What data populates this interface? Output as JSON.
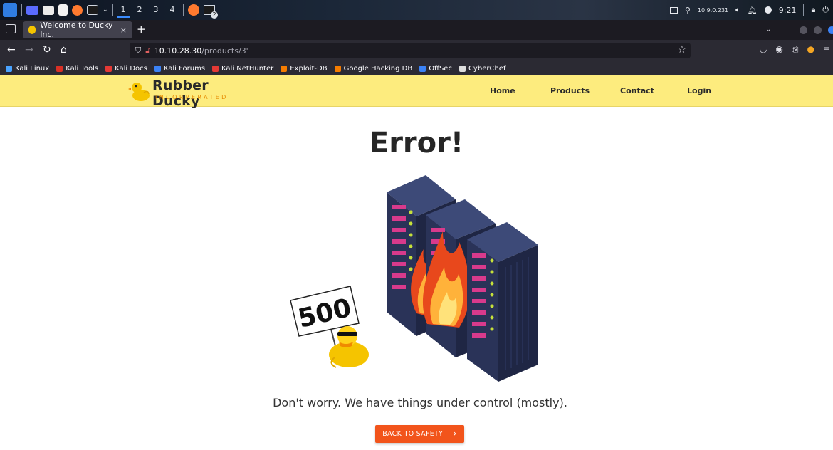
{
  "os": {
    "workspaces": [
      "1",
      "2",
      "3",
      "4"
    ],
    "active_workspace": "1",
    "ip": "10.9.0.231",
    "clock": "9:21",
    "terminal_badge": "2"
  },
  "browser": {
    "tab_title": "Welcome to Ducky Inc.",
    "tab_close": "×",
    "new_tab": "+",
    "url_host": "10.10.28.30",
    "url_path": "/products/3'",
    "bookmarks": [
      {
        "label": "Kali Linux",
        "color": "#4aa3ff"
      },
      {
        "label": "Kali Tools",
        "color": "#d93025"
      },
      {
        "label": "Kali Docs",
        "color": "#e53935"
      },
      {
        "label": "Kali Forums",
        "color": "#3b82f6"
      },
      {
        "label": "Kali NetHunter",
        "color": "#e53935"
      },
      {
        "label": "Exploit-DB",
        "color": "#f57c00"
      },
      {
        "label": "Google Hacking DB",
        "color": "#f57c00"
      },
      {
        "label": "OffSec",
        "color": "#3b82f6"
      },
      {
        "label": "CyberChef",
        "color": "#dddddd"
      }
    ]
  },
  "site": {
    "brand": "Rubber Ducky",
    "brand_sub": "INCORPERATED",
    "menu": [
      "Home",
      "Products",
      "Contact",
      "Login"
    ]
  },
  "main": {
    "title": "Error!",
    "sign_text": "500",
    "message": "Don't worry. We have things under control (mostly).",
    "button_label": "BACK TO SAFETY",
    "button_chevron": "›"
  },
  "colors": {
    "header_bg": "#fdec7e",
    "button_bg": "#f2541b",
    "brand_orange": "#e68a00"
  }
}
